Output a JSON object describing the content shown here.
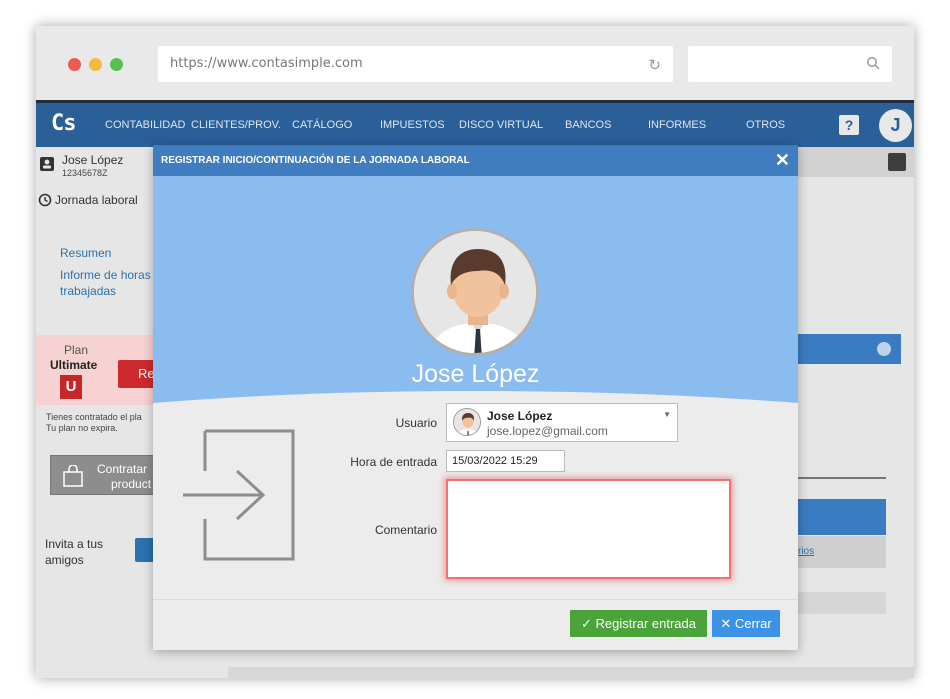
{
  "browser": {
    "url": "https://www.contasimple.com"
  },
  "app": {
    "logo": "Cs",
    "nav": [
      "CONTABILIDAD",
      "CLIENTES/PROV.",
      "CATÁLOGO",
      "IMPUESTOS",
      "DISCO VIRTUAL",
      "BANCOS",
      "INFORMES",
      "OTROS"
    ],
    "help": "?",
    "user_initial": "J"
  },
  "sidebar": {
    "user_name": "Jose López",
    "user_id": "12345678Z",
    "section": "Jornada laboral",
    "links": [
      "Resumen",
      "Informe de horas trabajadas"
    ],
    "plan_label": "Plan",
    "plan_name": "Ultimate",
    "plan_badge": "U",
    "plan_button": "Re",
    "plan_note_1": "Tienes contratado el pla",
    "plan_note_2": "Tu plan no expira.",
    "contratar_1": "Contratar",
    "contratar_2": "product",
    "invita": "Invita a tus amigos"
  },
  "background": {
    "column_link": "rios"
  },
  "modal": {
    "title": "REGISTRAR INICIO/CONTINUACIÓN DE LA JORNADA LABORAL",
    "close": "✕",
    "hero_name": "Jose López",
    "fields": {
      "usuario_label": "Usuario",
      "usuario_name": "Jose López",
      "usuario_email": "jose.lopez@gmail.com",
      "hora_label": "Hora de entrada",
      "hora_value": "15/03/2022 15:29",
      "comentario_label": "Comentario",
      "comentario_value": ""
    },
    "buttons": {
      "register": "Registrar entrada",
      "close": "Cerrar"
    }
  },
  "colors": {
    "nav": "#2a5f98",
    "modal_header": "#3f7cc0",
    "hero": "#8bbcef",
    "green": "#4aa43a",
    "blue": "#3c93e6",
    "plan_red": "#cc2a2e"
  }
}
